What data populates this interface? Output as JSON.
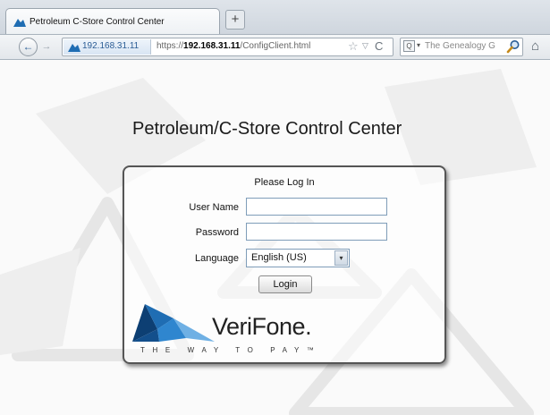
{
  "browser": {
    "tab": {
      "title": "Petroleum C-Store Control Center"
    },
    "new_tab": "+",
    "nav": {
      "back_icon": "←",
      "forward_icon": "→",
      "identity_host": "192.168.31.11",
      "url_prefix": "https://",
      "url_host": "192.168.31.11",
      "url_path": "/ConfigClient.html",
      "star_icon": "☆",
      "dropdown_icon": "▽",
      "reload_icon": "C"
    },
    "search": {
      "engine_icon": "Q",
      "dropdown": "▾",
      "placeholder": "The Genealogy G"
    },
    "home_icon": "⌂"
  },
  "page": {
    "title": "Petroleum/C-Store Control Center",
    "login": {
      "heading": "Please Log In",
      "username_label": "User Name",
      "username_value": "",
      "password_label": "Password",
      "password_value": "",
      "language_label": "Language",
      "language_value": "English (US)",
      "language_arrow": "▾",
      "submit_label": "Login"
    },
    "logo": {
      "wordmark": "VeriFone",
      "tm": ".",
      "tagline": "THE WAY TO PAY™"
    }
  },
  "colors": {
    "logo_blue": "#1f6db3",
    "logo_dark_blue": "#0d3f73",
    "link_blue": "#2b5d95"
  }
}
